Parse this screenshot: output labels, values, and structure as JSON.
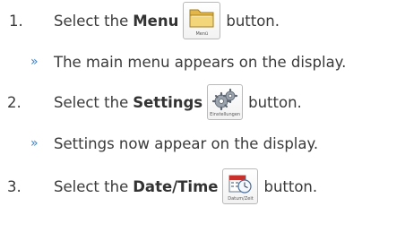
{
  "steps": [
    {
      "number": "1.",
      "prefix": "Select the",
      "bold": "Menu",
      "suffix": "button.",
      "icon": {
        "name": "folder-icon",
        "caption": "Menü"
      },
      "result": "The main menu appears on the display."
    },
    {
      "number": "2.",
      "prefix": "Select the",
      "bold": "Settings",
      "suffix": "button.",
      "icon": {
        "name": "gear-icon",
        "caption": "Einstellungen"
      },
      "result": "Settings now appear on the display."
    },
    {
      "number": "3.",
      "prefix": "Select the",
      "bold": "Date/Time",
      "suffix": "button.",
      "icon": {
        "name": "calendar-clock-icon",
        "caption": "Datum/Zeit"
      }
    }
  ],
  "bullet_glyph": "»",
  "colors": {
    "bullet": "#3b82c4",
    "text": "#3a3a3a"
  }
}
